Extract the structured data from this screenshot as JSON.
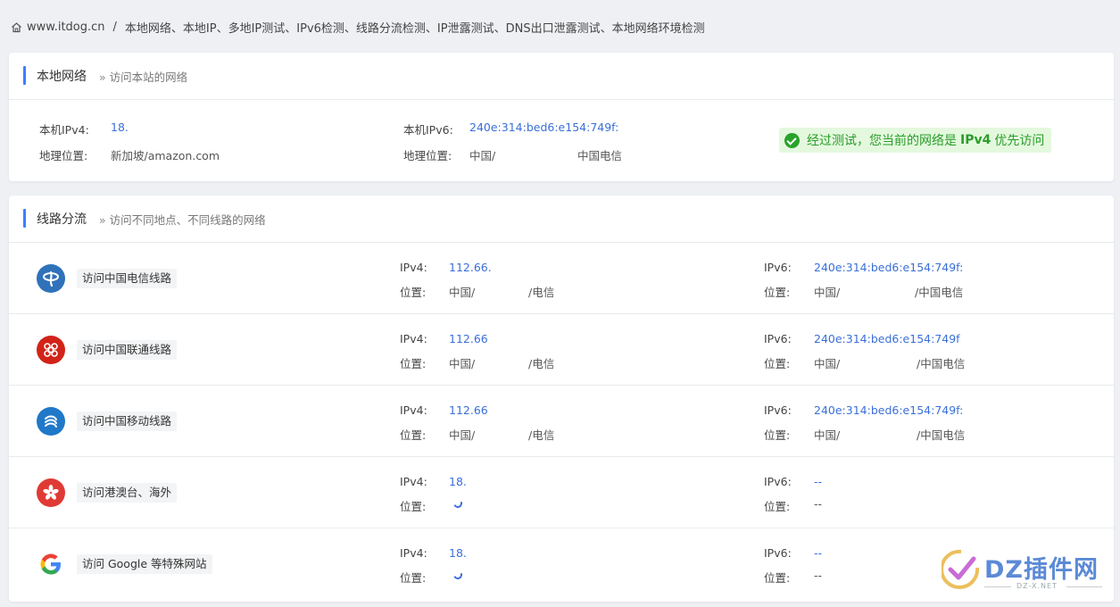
{
  "breadcrumb": {
    "home_icon": "home-icon",
    "site": "www.itdog.cn",
    "separator": "/",
    "page": "本地网络、本地IP、多地IP测试、IPv6检测、线路分流检测、IP泄露测试、DNS出口泄露测试、本地网络环境检测"
  },
  "local": {
    "title": "本地网络",
    "subtitle_marker": "»",
    "subtitle": "访问本站的网络",
    "ipv4_label": "本机IPv4:",
    "ipv4_value": "18.",
    "loc4_label": "地理位置:",
    "loc4_value": "新加坡/amazon.com",
    "ipv6_label": "本机IPv6:",
    "ipv6_value": "240e:314:bed6:e154:749f:",
    "loc6_label": "地理位置:",
    "loc6_value_a": "中国/",
    "loc6_value_b": "中国电信",
    "badge": {
      "icon": "check-circle-icon",
      "pre": "经过测试，您当前的网络是",
      "strong": "IPv4",
      "post": "优先访问",
      "color": "#2a9d2a"
    }
  },
  "route": {
    "title": "线路分流",
    "subtitle_marker": "»",
    "subtitle": "访问不同地点、不同线路的网络",
    "ipv4_label": "IPv4:",
    "ipv6_label": "IPv6:",
    "loc_label": "位置:",
    "rows": [
      {
        "icon": "china-telecom-icon",
        "name": "访问中国电信线路",
        "ipv4": "112.66.",
        "loc4_a": "中国/",
        "loc4_b": "/电信",
        "ipv6": "240e:314:bed6:e154:749f:",
        "loc6_a": "中国/",
        "loc6_b": "/中国电信"
      },
      {
        "icon": "china-unicom-icon",
        "name": "访问中国联通线路",
        "ipv4": "112.66",
        "loc4_a": "中国/",
        "loc4_b": "/电信",
        "ipv6": "240e:314:bed6:e154:749f",
        "loc6_a": "中国/",
        "loc6_b": "/中国电信"
      },
      {
        "icon": "china-mobile-icon",
        "name": "访问中国移动线路",
        "ipv4": "112.66",
        "loc4_a": "中国/",
        "loc4_b": "/电信",
        "ipv6": "240e:314:bed6:e154:749f:",
        "loc6_a": "中国/",
        "loc6_b": "/中国电信"
      },
      {
        "icon": "hong-kong-flower-icon",
        "name": "访问港澳台、海外",
        "ipv4": "18.",
        "loc4_loading": true,
        "ipv6": "--",
        "loc6_a": "--"
      },
      {
        "icon": "google-icon",
        "name": "访问 Google 等特殊网站",
        "ipv4": "18.",
        "loc4_loading": true,
        "ipv6": "--",
        "loc6_a": "--"
      }
    ]
  },
  "watermark": {
    "text": "DZ插件网",
    "sub": "DZ-X.NET"
  },
  "colors": {
    "accent": "#3d7eff",
    "link": "#3a6fd8",
    "success_bg": "#e4f8de",
    "page_bg": "#eef0f4"
  }
}
